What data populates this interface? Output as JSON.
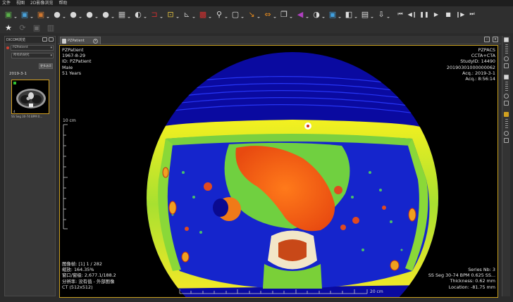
{
  "menu": [
    "文件",
    "视图",
    "2D影像浏览",
    "帮助"
  ],
  "toolbar": {
    "icons": [
      {
        "name": "open-study-icon",
        "glyph": "▣",
        "color": "#5ab04a"
      },
      {
        "name": "import-icon",
        "glyph": "▣",
        "color": "#48a0d8"
      },
      {
        "name": "export-icon",
        "glyph": "▣",
        "color": "#d07830"
      },
      {
        "name": "pan-icon",
        "glyph": "●",
        "color": "#d8d8d8"
      },
      {
        "name": "window-level-icon",
        "glyph": "●",
        "color": "#d8d8d8"
      },
      {
        "name": "zoom-tool-icon",
        "glyph": "●",
        "color": "#d8d8d8"
      },
      {
        "name": "rotate-tool-icon",
        "glyph": "●",
        "color": "#d8d8d8"
      },
      {
        "name": "layout-grid-icon",
        "glyph": "▦",
        "color": "#bbbbbb"
      },
      {
        "name": "measure-icon",
        "glyph": "◐",
        "color": "#d8d8d8"
      },
      {
        "name": "annotation-icon",
        "glyph": "⊐",
        "color": "#d03030"
      },
      {
        "name": "roi-icon",
        "glyph": "⊡",
        "color": "#e0c040"
      },
      {
        "name": "angle-icon",
        "glyph": "⊾",
        "color": "#bbbbbb"
      },
      {
        "name": "rectangle-roi-icon",
        "glyph": "▩",
        "color": "#d03030"
      },
      {
        "name": "magnifier-icon",
        "glyph": "⚲",
        "color": "#dddddd"
      },
      {
        "name": "probe-icon",
        "glyph": "▢",
        "color": "#dddddd"
      },
      {
        "name": "arrow-icon",
        "glyph": "↘",
        "color": "#e08820"
      },
      {
        "name": "flip-icon",
        "glyph": "⇔",
        "color": "#e08820"
      },
      {
        "name": "copy-icon",
        "glyph": "❐",
        "color": "#dddddd"
      },
      {
        "name": "reset-icon",
        "glyph": "◀",
        "color": "#b040c0"
      },
      {
        "name": "invert-icon",
        "glyph": "◑",
        "color": "#dddddd"
      },
      {
        "name": "pseudo-color-icon",
        "glyph": "▣",
        "color": "#40a0e0"
      },
      {
        "name": "mpr-icon",
        "glyph": "◧",
        "color": "#dddddd"
      },
      {
        "name": "save-image-icon",
        "glyph": "▤",
        "color": "#dddddd"
      },
      {
        "name": "download-icon",
        "glyph": "⇩",
        "color": "#dddddd"
      }
    ],
    "playback": [
      {
        "name": "first-frame-icon",
        "glyph": "⏮"
      },
      {
        "name": "prev-frame-icon",
        "glyph": "◀❙"
      },
      {
        "name": "pause-icon",
        "glyph": "❚❚"
      },
      {
        "name": "play-icon",
        "glyph": "▶"
      },
      {
        "name": "stop-icon",
        "glyph": "■"
      },
      {
        "name": "next-frame-icon",
        "glyph": "❙▶"
      },
      {
        "name": "last-frame-icon",
        "glyph": "⏭"
      }
    ],
    "row2": [
      {
        "name": "favorite-icon",
        "glyph": "★",
        "dim": false
      },
      {
        "name": "refresh-icon",
        "glyph": "⟳",
        "dim": true
      },
      {
        "name": "mark-icon",
        "glyph": "▣",
        "dim": true
      },
      {
        "name": "delete-icon",
        "glyph": "▥",
        "dim": true
      }
    ]
  },
  "left_panel": {
    "title": "DICOM浏览",
    "patient_select": "PZPatient",
    "series_select": "所有的研究",
    "more_button": "更多选项",
    "date": "2019-3-1",
    "thumbnail_label": "SS Seg 30-74 BPM 0..."
  },
  "viewer": {
    "tab_label": "PZPatient",
    "overlay_top_left": [
      "PZPatient",
      "1967-8-29",
      "ID: PZPatient",
      "Male",
      "51 Years"
    ],
    "overlay_top_right": [
      "PZPACS",
      "CCTA+CTA",
      "StudyID: 14490",
      "20190301000000062",
      "Acq.: 2019-3-1",
      "Acq.: 8:56:14"
    ],
    "overlay_bottom_left": [
      "图像帧:   [1] 1 / 282",
      "缩放: 164.35%",
      "窗口/窗级: 2,677.1/188.2",
      "分辨率: 没有值 - 外部图像",
      "CT (512x512)"
    ],
    "overlay_bottom_right": [
      "Series Nb: 3",
      "SS Seg 30-74 BPM 0.625 SS...",
      "Thickness: 0.62 mm",
      "Location: -81.75 mm"
    ],
    "scale_vertical_label": "10 cm",
    "scale_horizontal_label": "20 cm"
  },
  "colors": {
    "viewport_border": "#c9a020",
    "thumbnail_border": "#d4a020",
    "background": "#2b2b2b"
  }
}
